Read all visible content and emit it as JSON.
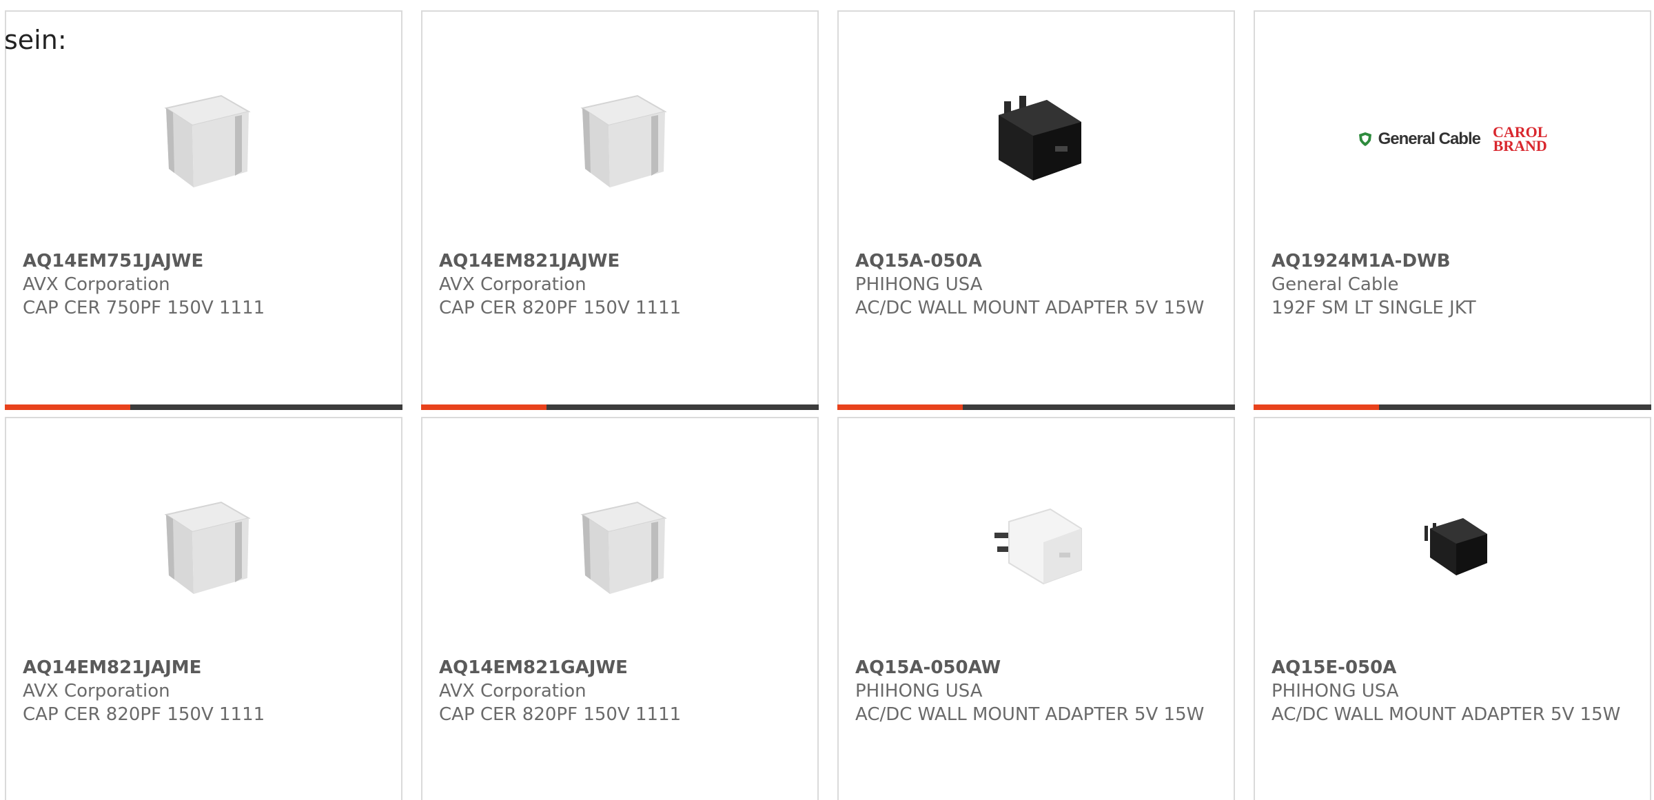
{
  "lead_text": "sein:",
  "colors": {
    "accent": "#e8421c",
    "bar": "#3c3c3c",
    "border": "#dadada",
    "text": "#6a6a6a"
  },
  "products": [
    {
      "part_number": "AQ14EM751JAJWE",
      "manufacturer": "AVX Corporation",
      "description": "CAP CER 750PF 150V 1111",
      "image": "ceramic-capacitor-image"
    },
    {
      "part_number": "AQ14EM821JAJWE",
      "manufacturer": "AVX Corporation",
      "description": "CAP CER 820PF 150V 1111",
      "image": "ceramic-capacitor-image"
    },
    {
      "part_number": "AQ15A-050A",
      "manufacturer": "PHIHONG USA",
      "description": "AC/DC WALL MOUNT ADAPTER 5V 15W",
      "image": "black-us-adapter-image"
    },
    {
      "part_number": "AQ1924M1A-DWB",
      "manufacturer": "General Cable",
      "description": "192F SM LT SINGLE JKT",
      "image": "general-cable-logo",
      "logo": {
        "brand": "General Cable",
        "sub_brand_line1": "CAROL",
        "sub_brand_line2": "BRAND"
      }
    },
    {
      "part_number": "AQ14EM821JAJME",
      "manufacturer": "AVX Corporation",
      "description": "CAP CER 820PF 150V 1111",
      "image": "ceramic-capacitor-image"
    },
    {
      "part_number": "AQ14EM821GAJWE",
      "manufacturer": "AVX Corporation",
      "description": "CAP CER 820PF 150V 1111",
      "image": "ceramic-capacitor-image"
    },
    {
      "part_number": "AQ15A-050AW",
      "manufacturer": "PHIHONG USA",
      "description": "AC/DC WALL MOUNT ADAPTER 5V 15W",
      "image": "white-us-adapter-image"
    },
    {
      "part_number": "AQ15E-050A",
      "manufacturer": "PHIHONG USA",
      "description": "AC/DC WALL MOUNT ADAPTER 5V 15W",
      "image": "black-eu-adapter-image"
    }
  ]
}
